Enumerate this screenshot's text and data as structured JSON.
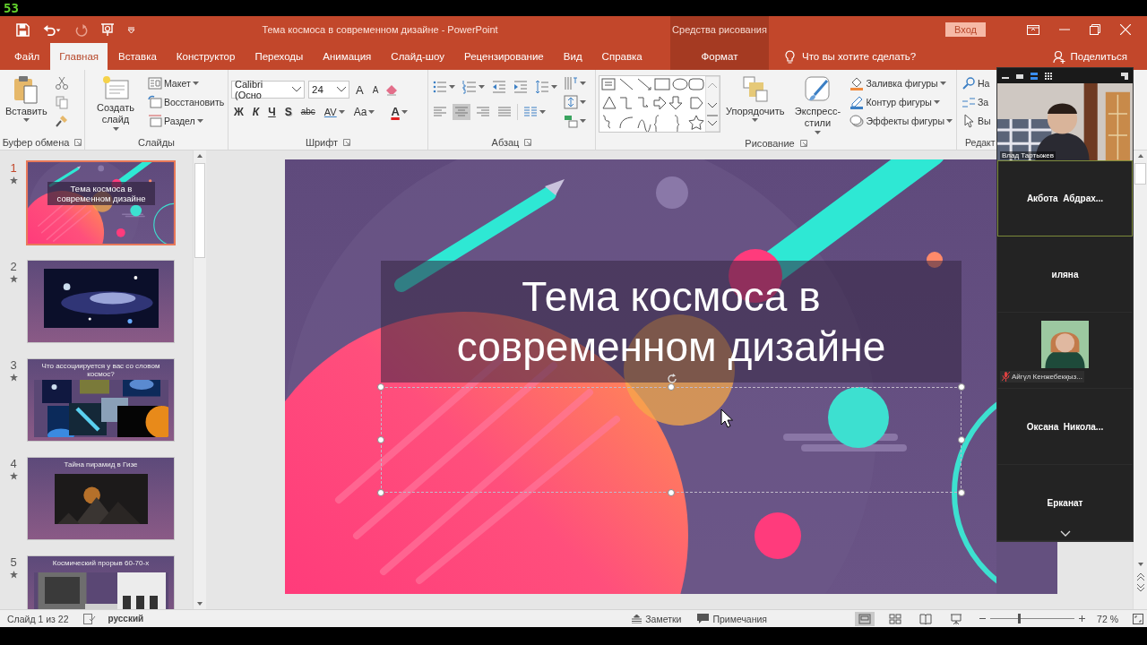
{
  "screen_counter": "53",
  "window": {
    "title": "Тема космоса в современном дизайне - PowerPoint",
    "context_group": "Средства рисования",
    "sign_in": "Вход"
  },
  "tabs": [
    {
      "label": "Файл",
      "kind": "file",
      "selected": false
    },
    {
      "label": "Главная",
      "kind": "tab",
      "selected": true
    },
    {
      "label": "Вставка",
      "kind": "tab",
      "selected": false
    },
    {
      "label": "Конструктор",
      "kind": "tab",
      "selected": false
    },
    {
      "label": "Переходы",
      "kind": "tab",
      "selected": false
    },
    {
      "label": "Анимация",
      "kind": "tab",
      "selected": false
    },
    {
      "label": "Слайд-шоу",
      "kind": "tab",
      "selected": false
    },
    {
      "label": "Рецензирование",
      "kind": "tab",
      "selected": false
    },
    {
      "label": "Вид",
      "kind": "tab",
      "selected": false
    },
    {
      "label": "Справка",
      "kind": "tab",
      "selected": false
    },
    {
      "label": "Формат",
      "kind": "context",
      "selected": false
    }
  ],
  "tell_me": {
    "placeholder": "Что вы хотите сделать?"
  },
  "share": "Поделиться",
  "ribbon": {
    "clipboard": {
      "label": "Буфер обмена",
      "paste": "Вставить"
    },
    "slides": {
      "label": "Слайды",
      "new_slide": "Создать слайд",
      "layout": "Макет",
      "reset": "Восстановить",
      "section": "Раздел"
    },
    "font": {
      "label": "Шрифт",
      "name": "Calibri (Осно",
      "size": "24",
      "size_buttons": [
        {
          "label": "A",
          "kind": "grow"
        },
        {
          "label": "A",
          "kind": "shrink"
        }
      ],
      "format_buttons": [
        {
          "label": "Ж",
          "kind": "bold"
        },
        {
          "label": "К",
          "kind": "italic"
        },
        {
          "label": "Ч",
          "kind": "underline"
        },
        {
          "label": "S",
          "kind": "shadow"
        },
        {
          "label": "abc",
          "kind": "strike"
        },
        {
          "label": "AV",
          "kind": "spacing"
        },
        {
          "label": "Aa",
          "kind": "case"
        },
        {
          "label": "A",
          "kind": "color"
        }
      ]
    },
    "paragraph": {
      "label": "Абзац",
      "align": [
        {
          "selected": false
        },
        {
          "selected": true
        },
        {
          "selected": false
        },
        {
          "selected": false
        }
      ]
    },
    "drawing": {
      "label": "Рисование",
      "arrange": "Упорядочить",
      "quick_styles": "Экспресс-стили",
      "fill": "Заливка фигуры",
      "outline": "Контур фигуры",
      "effects": "Эффекты фигуры"
    },
    "editing": {
      "label": "Редакт",
      "find": "На",
      "replace": "За",
      "select": "Вы"
    }
  },
  "slides": [
    {
      "number": "1",
      "kind": "title",
      "selected": true,
      "title": "Тема космоса в современном дизайне"
    },
    {
      "number": "2",
      "selected": false
    },
    {
      "number": "3",
      "kind": "collage",
      "selected": false,
      "title": "Что ассоциируется у вас со словом космос?"
    },
    {
      "number": "4",
      "kind": "photo_title",
      "selected": false,
      "title": "Тайна пирамид в Гизе"
    },
    {
      "number": "5",
      "kind": "bw_title",
      "selected": false,
      "title": "Космический прорыв 60-70-х"
    }
  ],
  "current_slide": {
    "title": "Тема космоса в современном дизайне",
    "placeholder_selected": true
  },
  "zoom_panel": {
    "speaker": "Влад Тартыжев",
    "participants": [
      {
        "name": "Акбота  Абдрах...",
        "kind": "name",
        "active": true
      },
      {
        "name": "иляна",
        "kind": "name",
        "active": false
      },
      {
        "name": "Айгүл Кенжебекқыз...",
        "active": false
      },
      {
        "name": "Оксана  Никола...",
        "kind": "name",
        "active": false
      },
      {
        "name": "Ерканат",
        "kind": "name",
        "active": false
      }
    ]
  },
  "status_bar": {
    "slide_info": "Слайд 1 из 22",
    "language": "русский",
    "notes": "Заметки",
    "comments": "Примечания",
    "views": [
      {
        "selected": true
      },
      {
        "selected": false
      },
      {
        "selected": false
      },
      {
        "selected": false
      }
    ],
    "zoom_slider": {
      "level": 0.34
    },
    "zoom": "72 %"
  }
}
